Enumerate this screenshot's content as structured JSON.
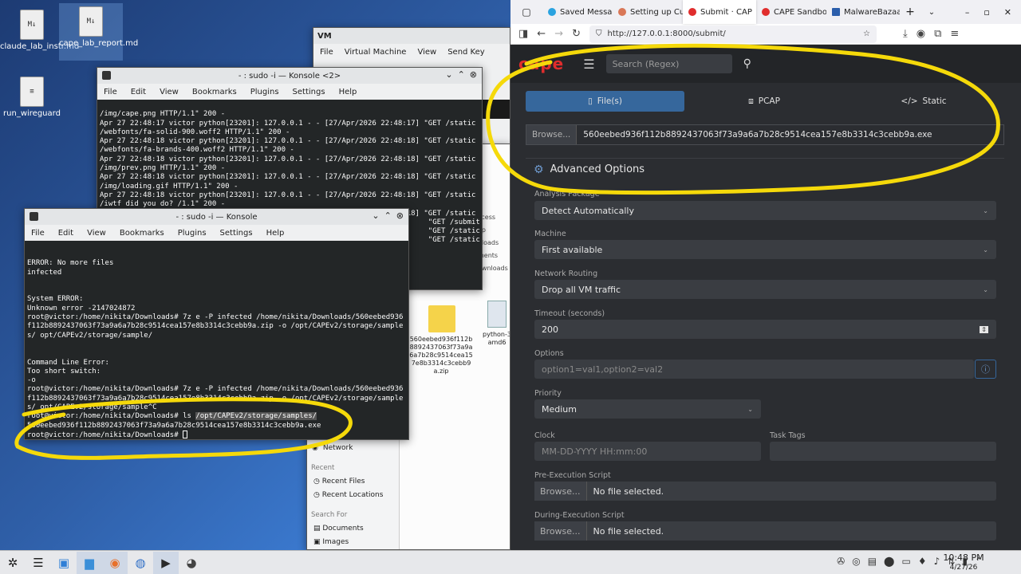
{
  "desktop": {
    "icons": [
      {
        "label": "claude_lab_instr.md",
        "glyph": "M↓"
      },
      {
        "label": "cape_lab_report.md",
        "glyph": "M↓"
      },
      {
        "label": "run_wireguard",
        "glyph": "≡"
      }
    ]
  },
  "vm_window": {
    "menu": [
      "File",
      "Virtual Machine",
      "View",
      "Send Key"
    ]
  },
  "konsole2": {
    "title": "- : sudo -i — Konsole <2>",
    "menu": [
      "File",
      "Edit",
      "View",
      "Bookmarks",
      "Plugins",
      "Settings",
      "Help"
    ],
    "lines": [
      "/img/cape.png HTTP/1.1\" 200 -",
      "Apr 27 22:48:17 victor python[23201]: 127.0.0.1 - - [27/Apr/2026 22:48:17] \"GET /static",
      "/webfonts/fa-solid-900.woff2 HTTP/1.1\" 200 -",
      "Apr 27 22:48:18 victor python[23201]: 127.0.0.1 - - [27/Apr/2026 22:48:18] \"GET /static",
      "/webfonts/fa-brands-400.woff2 HTTP/1.1\" 200 -",
      "Apr 27 22:48:18 victor python[23201]: 127.0.0.1 - - [27/Apr/2026 22:48:18] \"GET /static",
      "/img/prev.png HTTP/1.1\" 200 -",
      "Apr 27 22:48:18 victor python[23201]: 127.0.0.1 - - [27/Apr/2026 22:48:18] \"GET /static",
      "/img/loading.gif HTTP/1.1\" 200 -",
      "Apr 27 22:48:18 victor python[23201]: 127.0.0.1 - - [27/Apr/2026 22:48:18] \"GET /static",
      "/iwtf did you do? /1.1\" 200 -",
      "Apr 27 22:48:18 victor python[23201]: 127.0.0.1 - - [27/Apr/2026 22:48:18] \"GET /static",
      "                                                                            \"GET /submit",
      "                                                                            \"GET /static",
      "                                                                            \"GET /static"
    ]
  },
  "konsole1": {
    "title": "- : sudo -i — Konsole",
    "menu": [
      "File",
      "Edit",
      "View",
      "Bookmarks",
      "Plugins",
      "Settings",
      "Help"
    ],
    "lines": [
      "ERROR: No more files",
      "infected",
      "",
      "",
      "System ERROR:",
      "Unknown error -2147024872",
      "root@victor:/home/nikita/Downloads# 7z e -P infected /home/nikita/Downloads/560eebed936",
      "f112b8892437063f73a9a6a7b28c9514cea157e8b3314c3cebb9a.zip -o /opt/CAPEv2/storage/sample",
      "s/ opt/CAPEv2/storage/sample/",
      "",
      "",
      "Command Line Error:",
      "Too short switch:",
      "-o",
      "root@victor:/home/nikita/Downloads# 7z e -P infected /home/nikita/Downloads/560eebed936",
      "f112b8892437063f73a9a6a7b28c9514cea157e8b3314c3cebb9a.zip -o /opt/CAPEv2/storage/sample",
      "s/ opt/CAPEv2/storage/sample^C"
    ],
    "ls_prompt": "root@victor:/home/nikita/Downloads# ls ",
    "ls_path": "/opt/CAPEv2/storage/samples/",
    "ls_result": "560eebed936f112b8892437063f73a9a6a7b28c9514cea157e8b3314c3cebb9a.exe",
    "final_prompt": "root@victor:/home/nikita/Downloads# "
  },
  "filemanager": {
    "places": [
      "Network"
    ],
    "recent_header": "Recent",
    "recent": [
      "Recent Files",
      "Recent Locations"
    ],
    "search_header": "Search For",
    "search": [
      "Documents",
      "Images"
    ],
    "side_fragments": [
      "ccess",
      "op",
      "oloads",
      "ments",
      "ownloads"
    ],
    "file_zip": "560eebed936f112b8892437063f73a9a6a7b28c9514cea157e8b3314c3cebb9a.zip",
    "file_python": "python-3 amd6"
  },
  "browser": {
    "tabs": [
      {
        "label": "Saved Messag",
        "color": "#2aa3e0",
        "active": false
      },
      {
        "label": "Setting up Cu",
        "color": "#d97757",
        "active": false
      },
      {
        "label": "Submit · CAP",
        "color": "#e02d2d",
        "active": true
      },
      {
        "label": "CAPE Sandbox",
        "color": "#e02d2d",
        "active": false
      },
      {
        "label": "MalwareBazaa",
        "color": "#2b5eab",
        "active": false
      }
    ],
    "url": "http://127.0.0.1:8000/submit/"
  },
  "cape": {
    "logo": "cape",
    "search_placeholder": "Search (Regex)",
    "submit_tabs": [
      "File(s)",
      "PCAP",
      "Static"
    ],
    "browse_label": "Browse...",
    "selected_file": "560eebed936f112b8892437063f73a9a6a7b28c9514cea157e8b3314c3cebb9a.exe",
    "advanced_title": "Advanced Options",
    "analysis_package": {
      "label": "Analysis Package",
      "value": "Detect Automatically"
    },
    "machine": {
      "label": "Machine",
      "value": "First available"
    },
    "network_routing": {
      "label": "Network Routing",
      "value": "Drop all VM traffic"
    },
    "timeout": {
      "label": "Timeout (seconds)",
      "value": "200"
    },
    "options": {
      "label": "Options",
      "placeholder": "option1=val1,option2=val2"
    },
    "priority": {
      "label": "Priority",
      "value": "Medium"
    },
    "clock": {
      "label": "Clock",
      "placeholder": "MM-DD-YYYY HH:mm:00"
    },
    "task_tags": {
      "label": "Task Tags"
    },
    "pre_exec": {
      "label": "Pre-Execution Script",
      "status": "No file selected."
    },
    "during_exec": {
      "label": "During-Execution Script",
      "status": "No file selected."
    }
  },
  "taskbar": {
    "time": "10:48 PM",
    "date": "4/27/26"
  },
  "colors": {
    "annotation": "#f5d90a",
    "cape_red": "#e02d2d",
    "active_tab": "#36679c"
  }
}
